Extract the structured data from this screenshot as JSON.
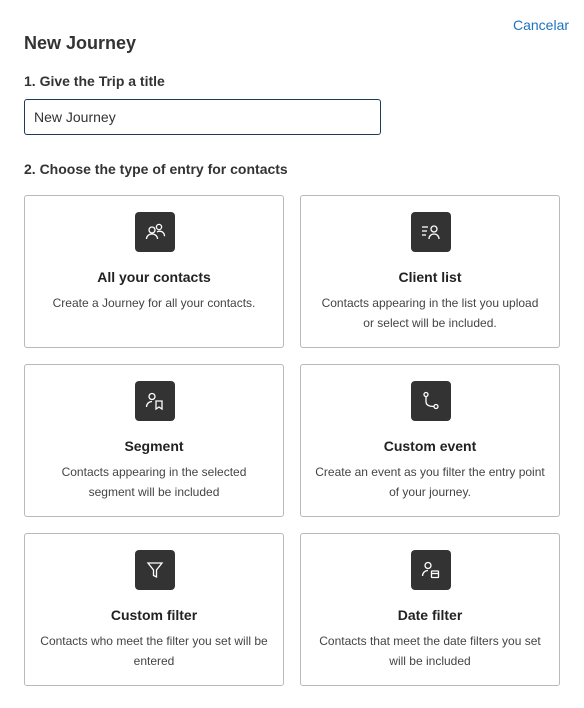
{
  "header": {
    "cancel_label": "Cancelar",
    "title": "New Journey"
  },
  "step1": {
    "label": "1. Give the Trip a title",
    "input_value": "New Journey"
  },
  "step2": {
    "label": "2. Choose the type of entry for contacts"
  },
  "cards": [
    {
      "icon": "contacts-icon",
      "title": "All your contacts",
      "description": "Create a Journey for all your contacts."
    },
    {
      "icon": "client-list-icon",
      "title": "Client list",
      "description": "Contacts appearing in the list you upload or select will be included."
    },
    {
      "icon": "segment-icon",
      "title": "Segment",
      "description": "Contacts appearing in the selected segment will be included"
    },
    {
      "icon": "custom-event-icon",
      "title": "Custom event",
      "description": "Create an event as you filter the entry point of your journey."
    },
    {
      "icon": "filter-icon",
      "title": "Custom filter",
      "description": "Contacts who meet the filter you set will be entered"
    },
    {
      "icon": "date-filter-icon",
      "title": "Date filter",
      "description": "Contacts that meet the date filters you set will be included"
    }
  ],
  "colors": {
    "accent": "#1e73be",
    "icon_bg": "#333333",
    "input_border": "#1b3a5c",
    "card_border": "#b9b9b9"
  }
}
